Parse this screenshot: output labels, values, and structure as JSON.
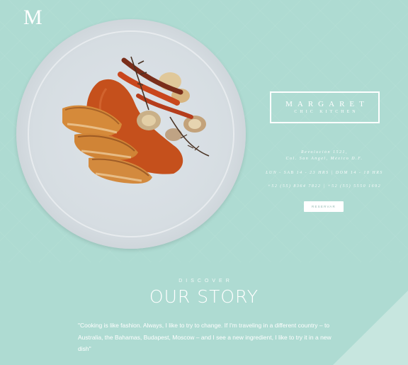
{
  "header": {
    "logo_text": "M"
  },
  "brand": {
    "name": "MARGARET",
    "subtitle": "CHIC KITCHEN"
  },
  "info": {
    "address_line1": "Revolución 1521,",
    "address_line2": "Col. San Angel, México D.F.",
    "hours": "LUN - SAB 14 - 23 HRS | DOM 14 - 18 HRS",
    "phones": "+52 (55) 8364 7822 | +52 (55) 5550 1692"
  },
  "reserve": {
    "label": "RESERVAR"
  },
  "story": {
    "kicker": "DISCOVER",
    "title": "OUR STORY",
    "quote": "\"Cooking is like fashion. Always, I like to try to change. If I'm traveling in a different country – to Australia, the Bahamas, Budapest, Moscow – and I see a new ingredient, I like to try it in a new dish\""
  },
  "colors": {
    "background": "#aedbd2",
    "corner_accent": "#c7e6df",
    "plate": "#dde3e8",
    "sauce": "#c5501c",
    "chicken": "#d58a3a"
  }
}
